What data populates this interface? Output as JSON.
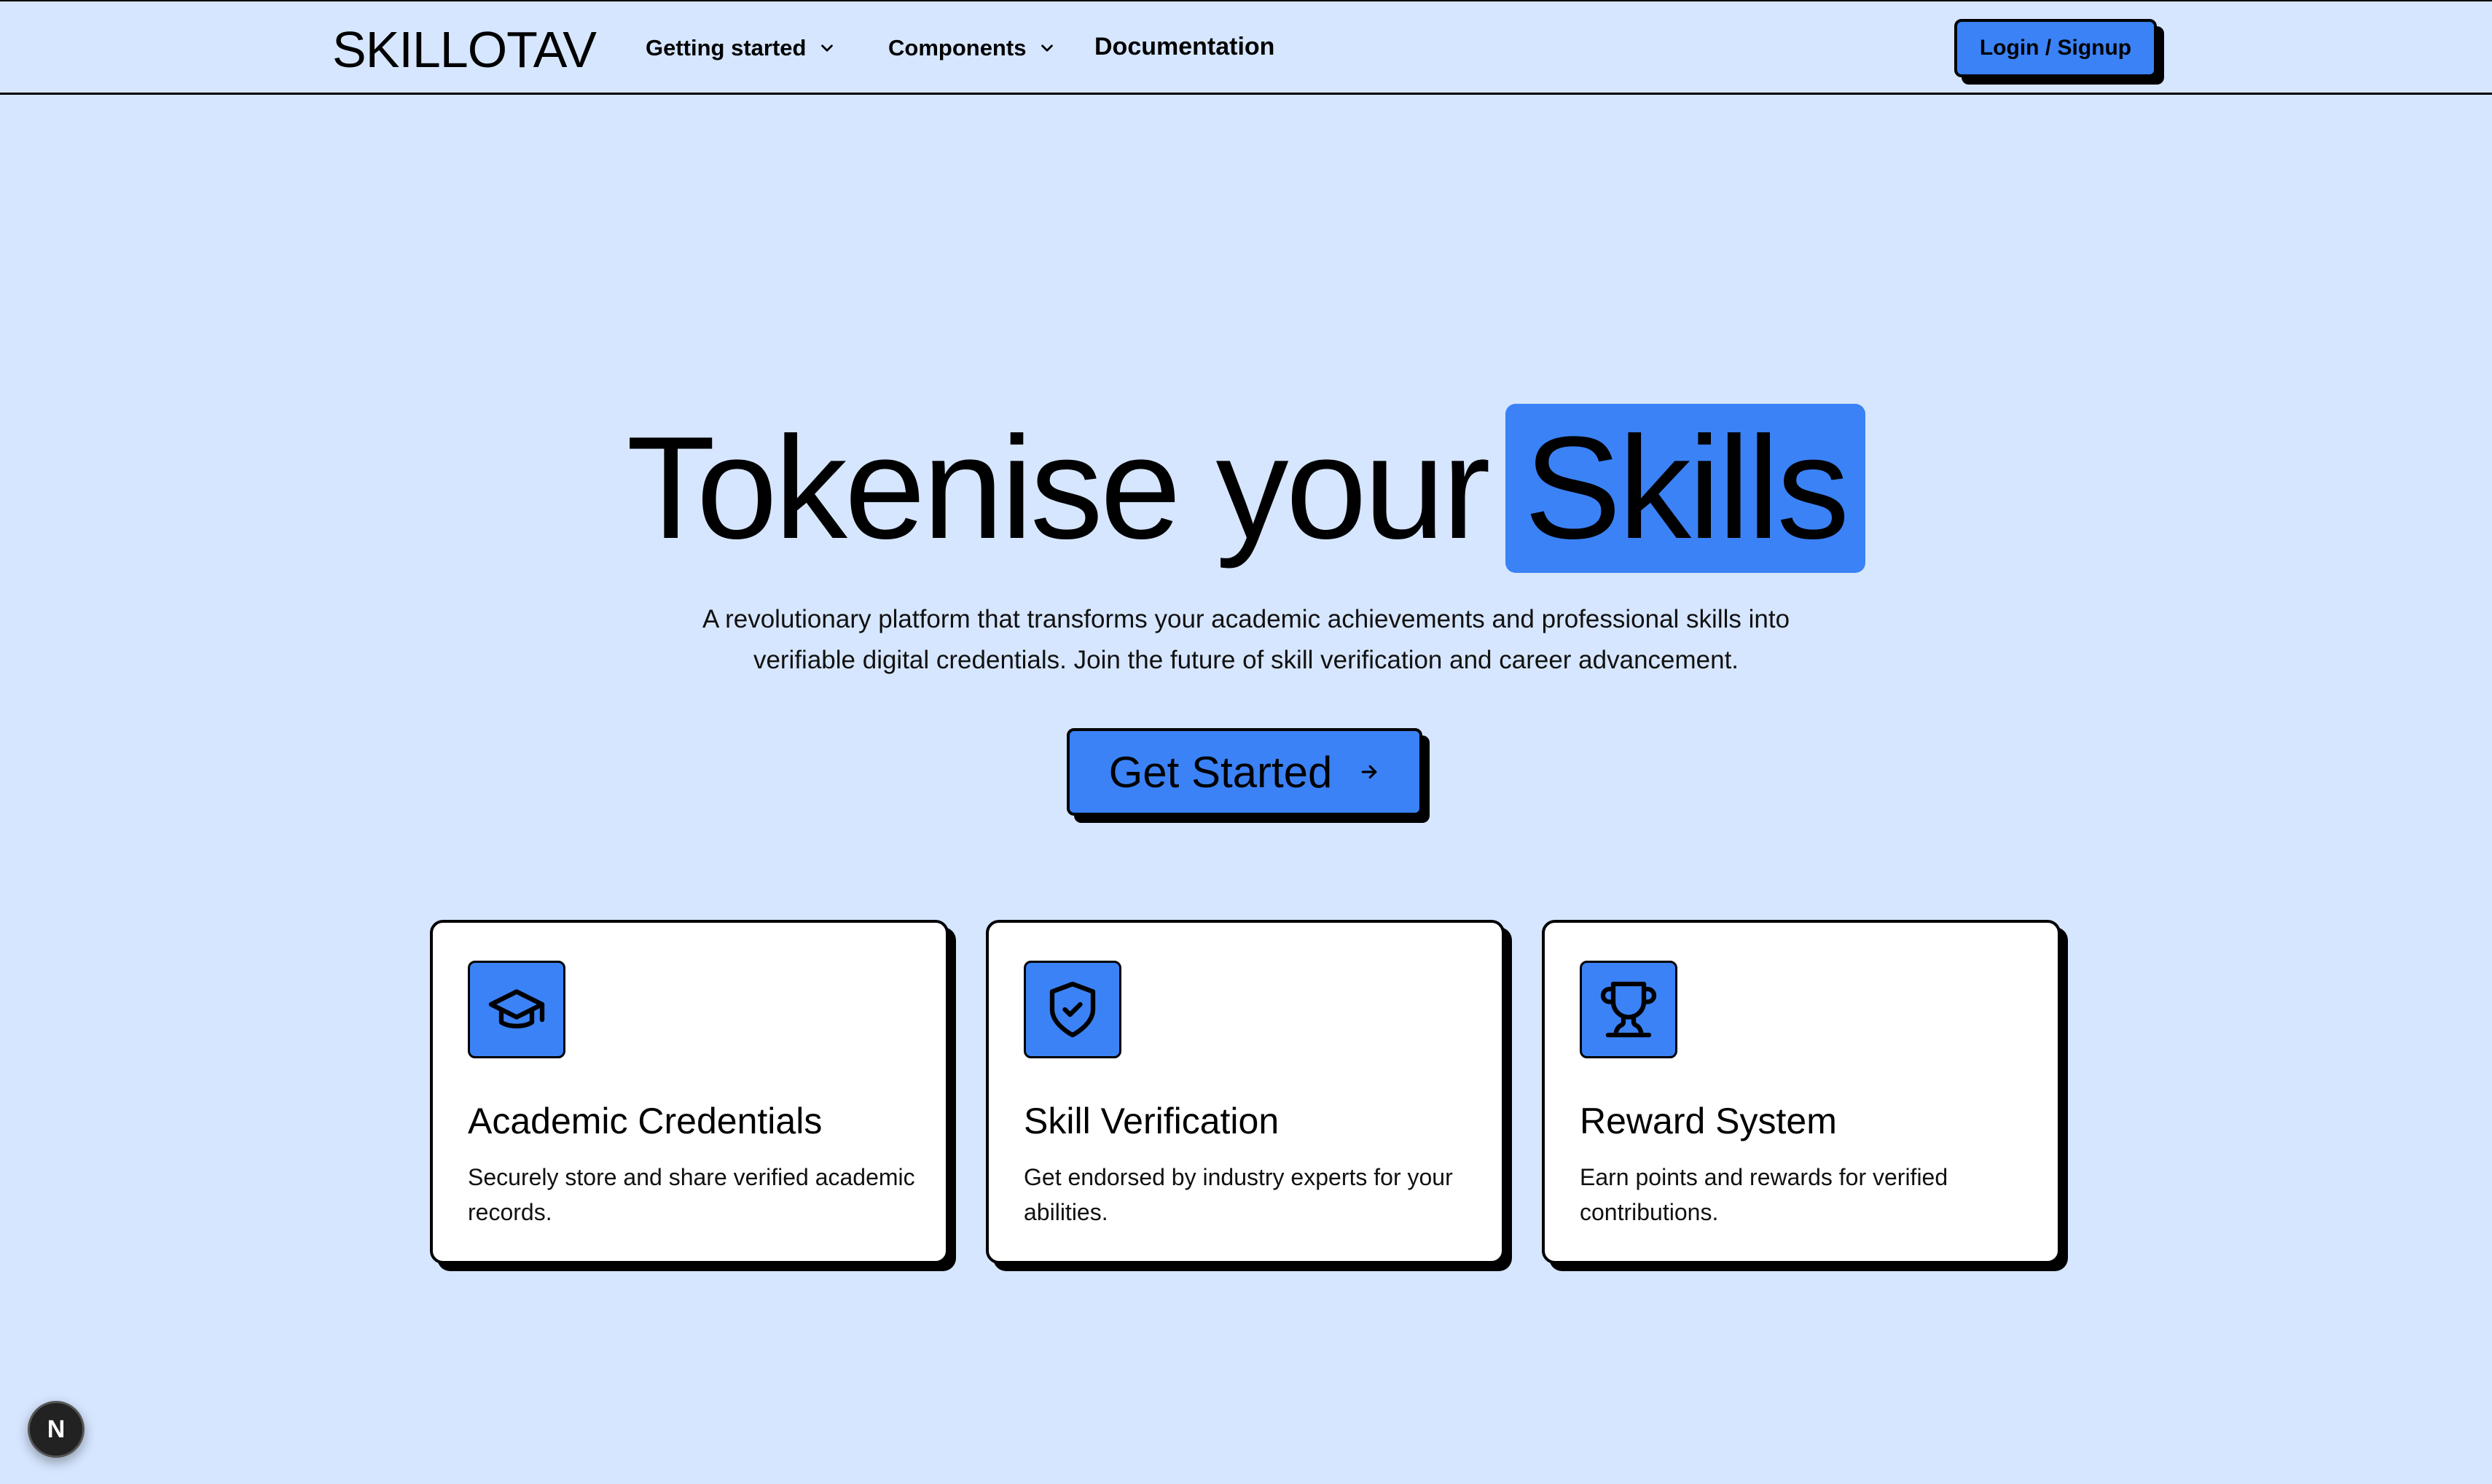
{
  "header": {
    "brand": "SKILLOTAV",
    "nav": [
      {
        "label": "Getting started",
        "icon": "chevron-down-icon"
      },
      {
        "label": "Components",
        "icon": "chevron-down-icon"
      },
      {
        "label": "Documentation"
      }
    ],
    "login_label": "Login / Signup"
  },
  "hero": {
    "title_plain": "Tokenise your",
    "title_highlight": "Skills",
    "subtitle": "A revolutionary platform that transforms your academic achievements and professional skills into verifiable digital credentials. Join the future of skill verification and career advancement.",
    "cta_label": "Get Started",
    "cta_icon": "arrow-right-icon"
  },
  "features": [
    {
      "icon": "graduation-cap-icon",
      "title": "Academic Credentials",
      "description": "Securely store and share verified academic records."
    },
    {
      "icon": "shield-check-icon",
      "title": "Skill Verification",
      "description": "Get endorsed by industry experts for your abilities."
    },
    {
      "icon": "trophy-icon",
      "title": "Reward System",
      "description": "Earn points and rewards for verified contributions."
    }
  ],
  "dev_badge": {
    "label": "N",
    "icon": "nextjs-icon"
  },
  "colors": {
    "background": "#d6e6ff",
    "accent": "#3b82f6",
    "border": "#000000",
    "card": "#ffffff"
  }
}
